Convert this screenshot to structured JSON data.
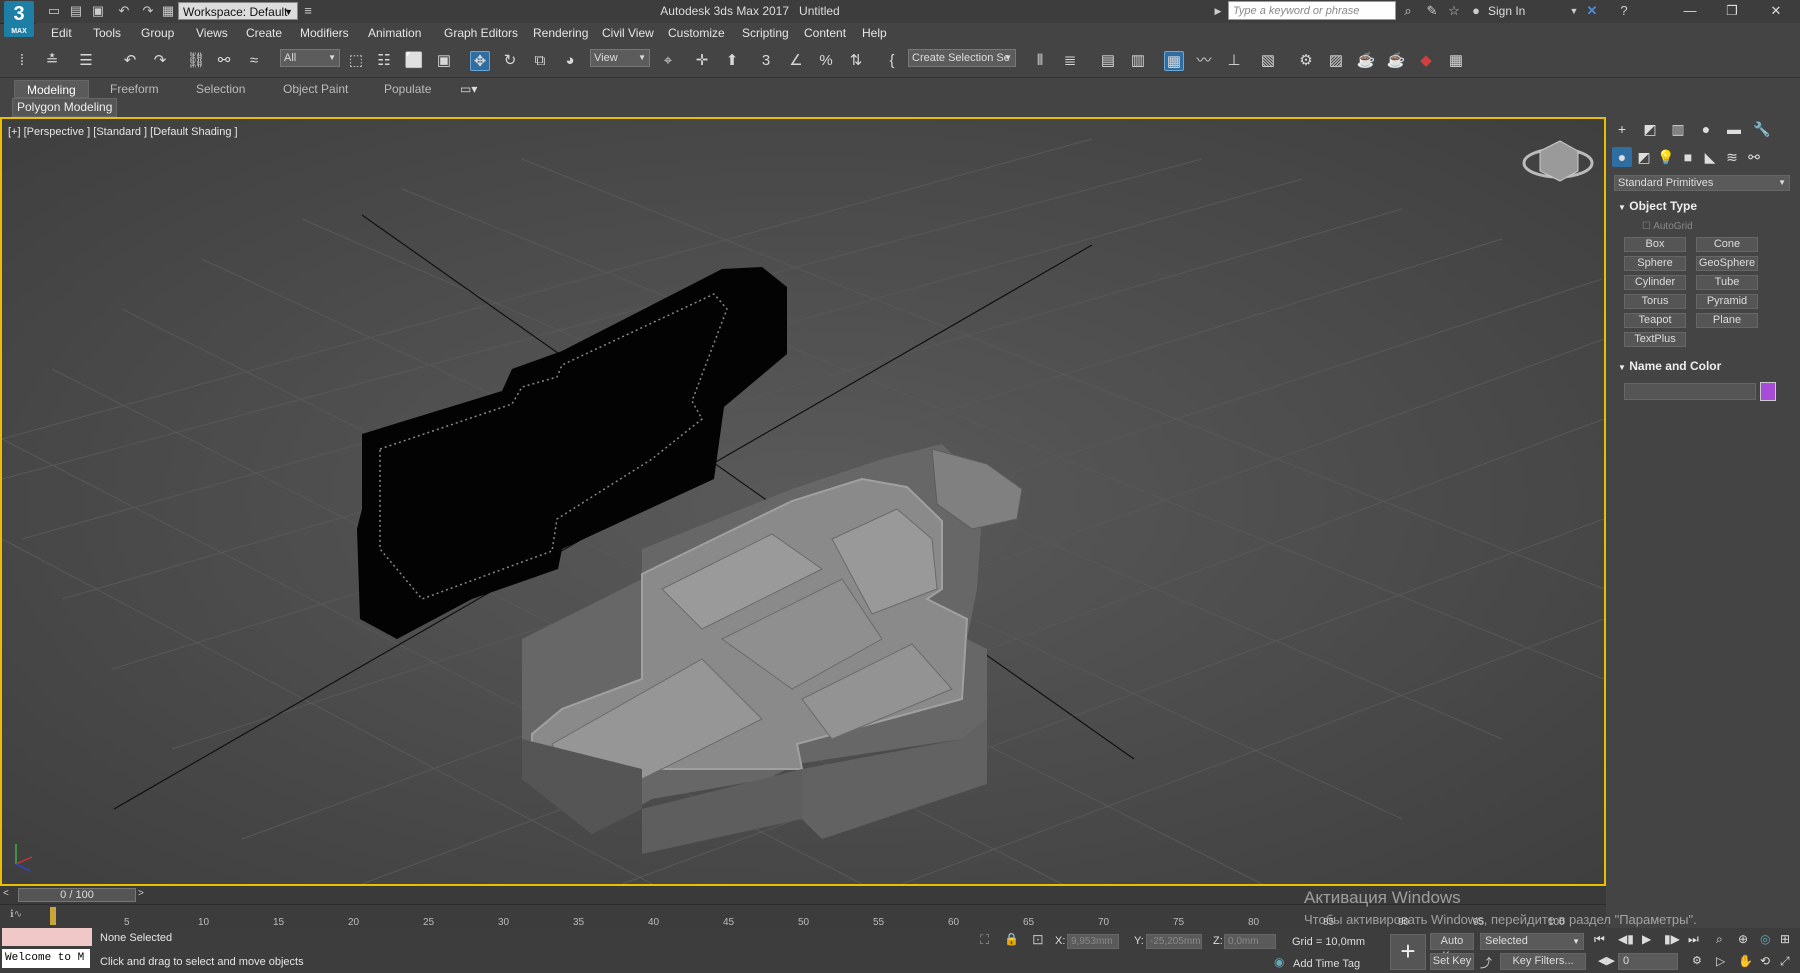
{
  "titlebar": {
    "workspace": "Workspace: Default",
    "app_title": "Autodesk 3ds Max 2017",
    "doc_title": "Untitled",
    "search_placeholder": "Type a keyword or phrase",
    "sign_in": "Sign In",
    "logo_text": "3",
    "logo_sub": "MAX"
  },
  "menu": [
    "Edit",
    "Tools",
    "Group",
    "Views",
    "Create",
    "Modifiers",
    "Animation",
    "Graph Editors",
    "Rendering",
    "Civil View",
    "Customize",
    "Scripting",
    "Content",
    "Help"
  ],
  "toolbar": {
    "selection_filter": "All",
    "ref_coord": "View",
    "selection_set": "Create Selection Se"
  },
  "ribbon": {
    "tabs": [
      "Modeling",
      "Freeform",
      "Selection",
      "Object Paint",
      "Populate"
    ],
    "panel": "Polygon Modeling"
  },
  "viewport": {
    "label": "[+] [Perspective ] [Standard ] [Default Shading ]"
  },
  "command_panel": {
    "category": "Standard Primitives",
    "object_type_title": "Object Type",
    "autogrid": "AutoGrid",
    "buttons": [
      "Box",
      "Cone",
      "Sphere",
      "GeoSphere",
      "Cylinder",
      "Tube",
      "Torus",
      "Pyramid",
      "Teapot",
      "Plane",
      "TextPlus"
    ],
    "name_color_title": "Name and Color",
    "color": "#a64cd6"
  },
  "timeline": {
    "frame": "0 / 100",
    "ticks": [
      "5",
      "10",
      "15",
      "20",
      "25",
      "30",
      "35",
      "40",
      "45",
      "50",
      "55",
      "60",
      "65",
      "70",
      "75",
      "80",
      "85",
      "90",
      "95",
      "100"
    ]
  },
  "status": {
    "listener": "Welcome to M",
    "selected": "None Selected",
    "prompt": "Click and drag to select and move objects",
    "x_label": "X:",
    "x_value": "9,953mm",
    "y_label": "Y:",
    "y_value": "-25,205mm",
    "z_label": "Z:",
    "z_value": "0,0mm",
    "grid": "Grid = 10,0mm",
    "add_time_tag": "Add Time Tag",
    "auto_key": "Auto Key",
    "key_mode": "Selected",
    "set_key": "Set Key",
    "key_filters": "Key Filters...",
    "frame_value": "0"
  },
  "watermark": {
    "line1": "Активация Windows",
    "line2": "Чтобы активировать Windows, перейдите в раздел \"Параметры\"."
  }
}
